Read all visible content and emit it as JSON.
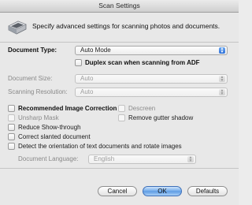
{
  "window": {
    "title": "Scan Settings"
  },
  "header": {
    "text": "Specify advanced settings for scanning photos and documents."
  },
  "document_type": {
    "label": "Document Type:",
    "value": "Auto Mode"
  },
  "duplex": {
    "label": "Duplex scan when scanning from ADF",
    "checked": false
  },
  "document_size": {
    "label": "Document Size:",
    "value": "Auto"
  },
  "scanning_resolution": {
    "label": "Scanning Resolution:",
    "value": "Auto"
  },
  "options": {
    "recommended_correction": "Recommended Image Correction",
    "descreen": "Descreen",
    "unsharp_mask": "Unsharp Mask",
    "remove_gutter": "Remove gutter shadow",
    "reduce_show_through": "Reduce Show-through",
    "correct_slanted": "Correct slanted document",
    "detect_orientation": "Detect the orientation of text documents and rotate images"
  },
  "document_language": {
    "label": "Document Language:",
    "value": "English"
  },
  "buttons": {
    "cancel": "Cancel",
    "ok": "OK",
    "defaults": "Defaults"
  },
  "icons": {
    "scanner": "scanner-icon",
    "dropdown": "chevron-updown-icon"
  },
  "colors": {
    "default_button": "#5c9ae3",
    "disabled_text": "#8a8a8a"
  }
}
